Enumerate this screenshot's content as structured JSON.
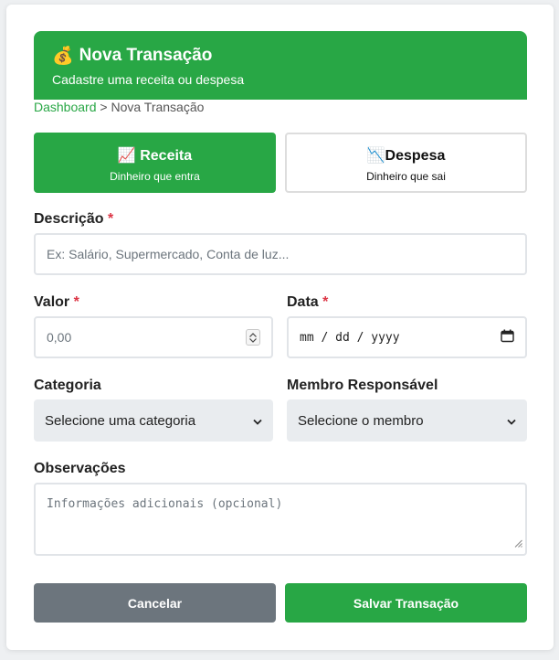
{
  "header": {
    "icon": "money-bag-icon",
    "icon_glyph": "💰",
    "title": "Nova Transação",
    "subtitle": "Cadastre uma receita ou despesa",
    "color": "#28a745"
  },
  "breadcrumb": {
    "home": "Dashboard",
    "separator": " > ",
    "current": "Nova Transação"
  },
  "type_selector": {
    "receita": {
      "icon_glyph": "📈",
      "label": "Receita",
      "sub": "Dinheiro que entra",
      "selected": true
    },
    "despesa": {
      "icon_glyph": "📉",
      "label": "Despesa",
      "sub": "Dinheiro que sai",
      "selected": false
    }
  },
  "form": {
    "descricao": {
      "label": "Descrição",
      "required_mark": "*",
      "placeholder": "Ex: Salário, Supermercado, Conta de luz..."
    },
    "valor": {
      "label": "Valor",
      "required_mark": "*",
      "placeholder": "0,00"
    },
    "data": {
      "label": "Data",
      "required_mark": "*",
      "placeholder": "mm / dd / yyyy"
    },
    "categoria": {
      "label": "Categoria",
      "selected": "Selecione uma categoria"
    },
    "membro": {
      "label": "Membro Responsável",
      "selected": "Selecione o membro"
    },
    "observacoes": {
      "label": "Observações",
      "placeholder": "Informações adicionais (opcional)"
    }
  },
  "actions": {
    "cancel_label": "Cancelar",
    "save_label": "Salvar Transação",
    "cancel_color": "#6c757d",
    "save_color": "#28a745"
  }
}
